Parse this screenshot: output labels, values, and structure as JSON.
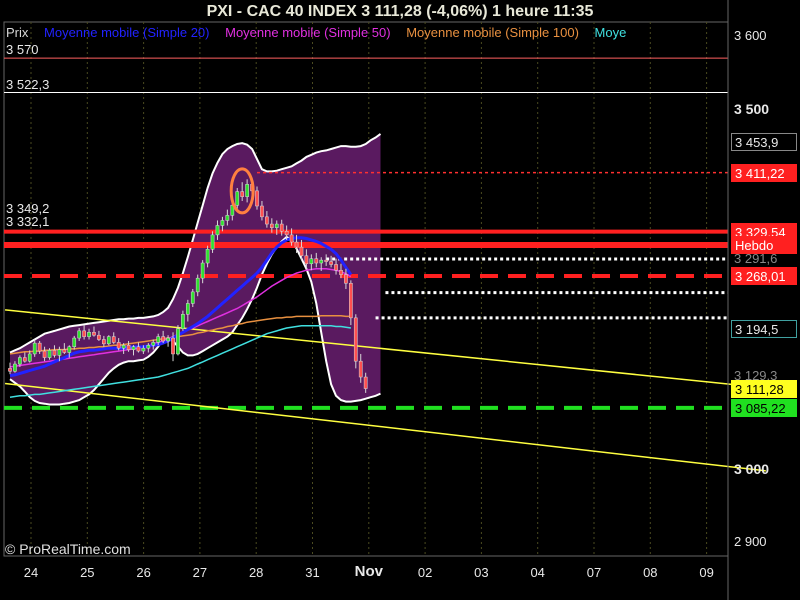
{
  "header": {
    "title": "PXI - CAC 40 INDEX     3 111,28 (-4,06%)     1 heure  11:35"
  },
  "legend": [
    {
      "label": "Prix",
      "color": "#d8d8d8"
    },
    {
      "label": "Moyenne mobile (Simple 20)",
      "color": "#2222ff"
    },
    {
      "label": "Moyenne mobile (Simple 50)",
      "color": "#e030e0"
    },
    {
      "label": "Moyenne mobile (Simple 100)",
      "color": "#e89040"
    },
    {
      "label": "Moye",
      "color": "#40e0e0"
    }
  ],
  "copyright": "© ProRealTime.com",
  "chart_data": {
    "type": "candlestick",
    "ylim": [
      2880,
      3620
    ],
    "y_ticks": [
      {
        "value": 3600,
        "label": "3 600",
        "major": false
      },
      {
        "value": 3500,
        "label": "3 500",
        "major": true
      },
      {
        "value": 3000,
        "label": "3 000",
        "major": true
      },
      {
        "value": 2900,
        "label": "2 900",
        "major": false
      }
    ],
    "x_labels": [
      {
        "label": "24",
        "bold": false
      },
      {
        "label": "25",
        "bold": false
      },
      {
        "label": "26",
        "bold": false
      },
      {
        "label": "27",
        "bold": false
      },
      {
        "label": "28",
        "bold": false
      },
      {
        "label": "31",
        "bold": false
      },
      {
        "label": "Nov",
        "bold": true
      },
      {
        "label": "02",
        "bold": false
      },
      {
        "label": "03",
        "bold": false
      },
      {
        "label": "04",
        "bold": false
      },
      {
        "label": "07",
        "bold": false
      },
      {
        "label": "08",
        "bold": false
      },
      {
        "label": "09",
        "bold": false
      }
    ],
    "price_boxes": [
      {
        "label": "3 453,9",
        "value": 3453.9,
        "bg": "#000000",
        "fg": "#e8e8e8",
        "border": "#888888"
      },
      {
        "label": "3 411,22",
        "value": 3411.22,
        "bg": "#ff2020",
        "fg": "#ffffff",
        "border": "#ff2020"
      },
      {
        "label": "3 329,54",
        "value": 3329.54,
        "bg": "#ff2020",
        "fg": "#ffffff",
        "border": "#ff2020"
      },
      {
        "label": "Hebdo",
        "value": 3311,
        "bg": "#ff2020",
        "fg": "#ffffff",
        "border": "#ff2020"
      },
      {
        "label": "3 268,01",
        "value": 3268.01,
        "bg": "#ff2020",
        "fg": "#ffffff",
        "border": "#ff2020"
      },
      {
        "label": "3 194,5",
        "value": 3194.5,
        "bg": "#000000",
        "fg": "#e8e8e8",
        "border": "#40a0a0"
      },
      {
        "label": "3 111,28",
        "value": 3111.28,
        "bg": "#ffff20",
        "fg": "#000000",
        "border": "#ffff20"
      },
      {
        "label": "3 085,22",
        "value": 3085.22,
        "bg": "#20e020",
        "fg": "#000000",
        "border": "#20e020"
      }
    ],
    "partial_labels": [
      {
        "label": "3 291,6",
        "value": 3291.6
      },
      {
        "label": "3 129,3",
        "value": 3129.3
      }
    ],
    "horizontal_labels": [
      {
        "label": "3 570",
        "value": 3570
      },
      {
        "label": "3 522,3",
        "value": 3522.3
      },
      {
        "label": "3 349,2",
        "value": 3349.2
      },
      {
        "label": "3 332,1",
        "value": 3332.1
      }
    ],
    "levels": [
      {
        "value": 3570,
        "color": "#ff6060",
        "style": "solid",
        "width": 1
      },
      {
        "value": 3522.3,
        "color": "#ffffff",
        "style": "solid",
        "width": 1
      },
      {
        "value": 3411.22,
        "color": "#ff3030",
        "style": "dotted",
        "width": 1.5,
        "from_index": 50
      },
      {
        "value": 3329.54,
        "color": "#ff2020",
        "style": "solid",
        "width": 4
      },
      {
        "value": 3311,
        "color": "#ff2020",
        "style": "solid",
        "width": 6
      },
      {
        "value": 3291.6,
        "color": "#ffffff",
        "style": "dotted",
        "width": 3,
        "from_index": 64
      },
      {
        "value": 3268.01,
        "color": "#ff2020",
        "style": "dashed",
        "width": 4
      },
      {
        "value": 3245,
        "color": "#ffffff",
        "style": "dotted",
        "width": 3,
        "from_index": 76
      },
      {
        "value": 3210,
        "color": "#ffffff",
        "style": "dotted",
        "width": 3,
        "from_index": 74
      },
      {
        "value": 3085.22,
        "color": "#20e020",
        "style": "dashed",
        "width": 4
      }
    ],
    "trendlines": [
      {
        "from": [
          -1,
          3221
        ],
        "to": [
          153,
          3113
        ],
        "color": "#ffff40"
      },
      {
        "from": [
          -1,
          3119
        ],
        "to": [
          153,
          2998
        ],
        "color": "#ffff40"
      }
    ],
    "bollinger": {
      "upper": [
        3162,
        3165,
        3168,
        3172,
        3176,
        3180,
        3184,
        3188,
        3190,
        3192,
        3194,
        3196,
        3198,
        3199,
        3200,
        3201,
        3202,
        3203,
        3204,
        3205,
        3206,
        3207,
        3208,
        3208,
        3209,
        3209,
        3210,
        3210,
        3211,
        3212,
        3214,
        3218,
        3224,
        3236,
        3252,
        3272,
        3294,
        3318,
        3342,
        3366,
        3390,
        3410,
        3425,
        3437,
        3444,
        3448,
        3451,
        3452,
        3450,
        3444,
        3430,
        3416,
        3413,
        3413,
        3414,
        3416,
        3418,
        3420,
        3424,
        3428,
        3433,
        3436,
        3439,
        3441,
        3442,
        3444,
        3446,
        3448,
        3448,
        3447,
        3447,
        3448,
        3451,
        3456,
        3460,
        3465
      ],
      "lower": [
        3125,
        3120,
        3115,
        3108,
        3100,
        3095,
        3092,
        3091,
        3090,
        3090,
        3090,
        3091,
        3092,
        3094,
        3096,
        3100,
        3104,
        3110,
        3118,
        3126,
        3134,
        3140,
        3145,
        3148,
        3150,
        3150,
        3151,
        3152,
        3156,
        3162,
        3170,
        3180,
        3182,
        3178,
        3170,
        3162,
        3158,
        3158,
        3160,
        3164,
        3168,
        3172,
        3176,
        3180,
        3184,
        3190,
        3200,
        3210,
        3222,
        3236,
        3252,
        3270,
        3285,
        3298,
        3308,
        3316,
        3322,
        3318,
        3306,
        3292,
        3278,
        3260,
        3230,
        3190,
        3150,
        3118,
        3102,
        3096,
        3094,
        3094,
        3095,
        3096,
        3098,
        3100,
        3102,
        3105
      ],
      "fill": "#5a1a60",
      "stroke": "#ffffff"
    },
    "ma20": [
      3130,
      3131,
      3133,
      3135,
      3137,
      3139,
      3141,
      3143,
      3146,
      3149,
      3152,
      3155,
      3158,
      3161,
      3163,
      3164,
      3165,
      3165,
      3166,
      3167,
      3168,
      3168,
      3168,
      3168,
      3169,
      3170,
      3170,
      3170,
      3171,
      3172,
      3173,
      3175,
      3178,
      3182,
      3186,
      3190,
      3194,
      3198,
      3202,
      3207,
      3212,
      3218,
      3224,
      3230,
      3236,
      3242,
      3248,
      3254,
      3260,
      3266,
      3272,
      3280,
      3290,
      3300,
      3308,
      3314,
      3318,
      3320,
      3321,
      3321,
      3320,
      3318,
      3316,
      3313,
      3309,
      3305,
      3299,
      3290,
      3280,
      3270
    ],
    "ma50": [
      3142,
      3143,
      3144,
      3145,
      3146,
      3147,
      3148,
      3149,
      3150,
      3151,
      3152,
      3153,
      3154,
      3155,
      3156,
      3157,
      3158,
      3159,
      3160,
      3161,
      3162,
      3163,
      3164,
      3165,
      3166,
      3167,
      3168,
      3170,
      3172,
      3174,
      3176,
      3178,
      3181,
      3184,
      3187,
      3190,
      3193,
      3196,
      3199,
      3202,
      3205,
      3208,
      3211,
      3214,
      3217,
      3220,
      3223,
      3227,
      3231,
      3235,
      3239,
      3244,
      3249,
      3254,
      3258,
      3262,
      3266,
      3269,
      3272,
      3274,
      3276,
      3277,
      3278,
      3278,
      3278,
      3277,
      3276,
      3274,
      3271,
      3267
    ],
    "ma100": [
      3160,
      3161,
      3162,
      3163,
      3163,
      3164,
      3164,
      3165,
      3165,
      3166,
      3166,
      3166,
      3167,
      3167,
      3168,
      3168,
      3169,
      3169,
      3170,
      3170,
      3171,
      3172,
      3172,
      3173,
      3174,
      3175,
      3176,
      3177,
      3178,
      3179,
      3180,
      3181,
      3182,
      3183,
      3184,
      3185,
      3186,
      3187,
      3189,
      3190,
      3192,
      3193,
      3195,
      3196,
      3198,
      3199,
      3201,
      3202,
      3204,
      3205,
      3206,
      3207,
      3208,
      3209,
      3210,
      3210,
      3211,
      3211,
      3212,
      3212,
      3212,
      3212,
      3212,
      3213,
      3213,
      3213,
      3213,
      3213,
      3212,
      3212
    ],
    "ma200": [
      3100,
      3101,
      3102,
      3102,
      3103,
      3104,
      3104,
      3105,
      3106,
      3107,
      3108,
      3109,
      3110,
      3111,
      3112,
      3113,
      3114,
      3115,
      3116,
      3117,
      3118,
      3119,
      3120,
      3121,
      3122,
      3123,
      3124,
      3125,
      3126,
      3127,
      3128,
      3130,
      3132,
      3134,
      3136,
      3138,
      3140,
      3143,
      3146,
      3149,
      3152,
      3155,
      3158,
      3161,
      3164,
      3167,
      3170,
      3173,
      3176,
      3179,
      3182,
      3185,
      3188,
      3190,
      3192,
      3194,
      3196,
      3197,
      3198,
      3199,
      3199,
      3199,
      3199,
      3199,
      3199,
      3199,
      3198,
      3198,
      3197,
      3196
    ],
    "ma_colors": {
      "ma20": "#2222ff",
      "ma50": "#e030e0",
      "ma100": "#e89040",
      "ma200": "#40e0e0"
    },
    "candles": [
      {
        "o": 3140,
        "h": 3148,
        "l": 3132,
        "c": 3136
      },
      {
        "o": 3136,
        "h": 3150,
        "l": 3134,
        "c": 3146
      },
      {
        "o": 3146,
        "h": 3158,
        "l": 3142,
        "c": 3155
      },
      {
        "o": 3155,
        "h": 3162,
        "l": 3148,
        "c": 3150
      },
      {
        "o": 3150,
        "h": 3165,
        "l": 3148,
        "c": 3160
      },
      {
        "o": 3160,
        "h": 3180,
        "l": 3156,
        "c": 3175
      },
      {
        "o": 3175,
        "h": 3178,
        "l": 3160,
        "c": 3164
      },
      {
        "o": 3164,
        "h": 3170,
        "l": 3150,
        "c": 3155
      },
      {
        "o": 3155,
        "h": 3168,
        "l": 3152,
        "c": 3165
      },
      {
        "o": 3165,
        "h": 3172,
        "l": 3155,
        "c": 3158
      },
      {
        "o": 3158,
        "h": 3170,
        "l": 3150,
        "c": 3166
      },
      {
        "o": 3166,
        "h": 3175,
        "l": 3160,
        "c": 3162
      },
      {
        "o": 3162,
        "h": 3172,
        "l": 3155,
        "c": 3170
      },
      {
        "o": 3170,
        "h": 3185,
        "l": 3166,
        "c": 3182
      },
      {
        "o": 3182,
        "h": 3196,
        "l": 3178,
        "c": 3192
      },
      {
        "o": 3192,
        "h": 3200,
        "l": 3180,
        "c": 3184
      },
      {
        "o": 3184,
        "h": 3195,
        "l": 3180,
        "c": 3190
      },
      {
        "o": 3190,
        "h": 3198,
        "l": 3184,
        "c": 3186
      },
      {
        "o": 3186,
        "h": 3192,
        "l": 3178,
        "c": 3180
      },
      {
        "o": 3180,
        "h": 3185,
        "l": 3170,
        "c": 3174
      },
      {
        "o": 3174,
        "h": 3186,
        "l": 3172,
        "c": 3184
      },
      {
        "o": 3184,
        "h": 3190,
        "l": 3174,
        "c": 3176
      },
      {
        "o": 3176,
        "h": 3182,
        "l": 3165,
        "c": 3168
      },
      {
        "o": 3168,
        "h": 3175,
        "l": 3160,
        "c": 3172
      },
      {
        "o": 3172,
        "h": 3178,
        "l": 3163,
        "c": 3166
      },
      {
        "o": 3166,
        "h": 3172,
        "l": 3158,
        "c": 3170
      },
      {
        "o": 3170,
        "h": 3176,
        "l": 3162,
        "c": 3164
      },
      {
        "o": 3164,
        "h": 3172,
        "l": 3160,
        "c": 3168
      },
      {
        "o": 3168,
        "h": 3175,
        "l": 3162,
        "c": 3172
      },
      {
        "o": 3172,
        "h": 3180,
        "l": 3166,
        "c": 3176
      },
      {
        "o": 3176,
        "h": 3188,
        "l": 3172,
        "c": 3184
      },
      {
        "o": 3184,
        "h": 3192,
        "l": 3175,
        "c": 3178
      },
      {
        "o": 3178,
        "h": 3186,
        "l": 3170,
        "c": 3182
      },
      {
        "o": 3182,
        "h": 3190,
        "l": 3150,
        "c": 3160
      },
      {
        "o": 3160,
        "h": 3200,
        "l": 3158,
        "c": 3195
      },
      {
        "o": 3195,
        "h": 3220,
        "l": 3192,
        "c": 3215
      },
      {
        "o": 3215,
        "h": 3235,
        "l": 3205,
        "c": 3230
      },
      {
        "o": 3230,
        "h": 3250,
        "l": 3225,
        "c": 3246
      },
      {
        "o": 3246,
        "h": 3270,
        "l": 3240,
        "c": 3265
      },
      {
        "o": 3265,
        "h": 3290,
        "l": 3258,
        "c": 3286
      },
      {
        "o": 3286,
        "h": 3310,
        "l": 3280,
        "c": 3305
      },
      {
        "o": 3305,
        "h": 3330,
        "l": 3300,
        "c": 3325
      },
      {
        "o": 3325,
        "h": 3345,
        "l": 3318,
        "c": 3338
      },
      {
        "o": 3338,
        "h": 3350,
        "l": 3330,
        "c": 3345
      },
      {
        "o": 3345,
        "h": 3360,
        "l": 3338,
        "c": 3352
      },
      {
        "o": 3352,
        "h": 3372,
        "l": 3345,
        "c": 3366
      },
      {
        "o": 3366,
        "h": 3390,
        "l": 3360,
        "c": 3385
      },
      {
        "o": 3385,
        "h": 3398,
        "l": 3372,
        "c": 3378
      },
      {
        "o": 3378,
        "h": 3402,
        "l": 3370,
        "c": 3395
      },
      {
        "o": 3395,
        "h": 3400,
        "l": 3380,
        "c": 3386
      },
      {
        "o": 3386,
        "h": 3392,
        "l": 3360,
        "c": 3365
      },
      {
        "o": 3365,
        "h": 3372,
        "l": 3345,
        "c": 3350
      },
      {
        "o": 3350,
        "h": 3358,
        "l": 3335,
        "c": 3340
      },
      {
        "o": 3340,
        "h": 3348,
        "l": 3328,
        "c": 3335
      },
      {
        "o": 3335,
        "h": 3345,
        "l": 3325,
        "c": 3340
      },
      {
        "o": 3340,
        "h": 3346,
        "l": 3324,
        "c": 3330
      },
      {
        "o": 3330,
        "h": 3338,
        "l": 3318,
        "c": 3325
      },
      {
        "o": 3325,
        "h": 3334,
        "l": 3310,
        "c": 3315
      },
      {
        "o": 3315,
        "h": 3325,
        "l": 3300,
        "c": 3308
      },
      {
        "o": 3308,
        "h": 3318,
        "l": 3290,
        "c": 3296
      },
      {
        "o": 3296,
        "h": 3305,
        "l": 3278,
        "c": 3285
      },
      {
        "o": 3285,
        "h": 3298,
        "l": 3276,
        "c": 3292
      },
      {
        "o": 3292,
        "h": 3300,
        "l": 3280,
        "c": 3286
      },
      {
        "o": 3286,
        "h": 3294,
        "l": 3275,
        "c": 3290
      },
      {
        "o": 3290,
        "h": 3298,
        "l": 3282,
        "c": 3288
      },
      {
        "o": 3288,
        "h": 3296,
        "l": 3280,
        "c": 3284
      },
      {
        "o": 3284,
        "h": 3292,
        "l": 3270,
        "c": 3276
      },
      {
        "o": 3276,
        "h": 3285,
        "l": 3265,
        "c": 3270
      },
      {
        "o": 3270,
        "h": 3278,
        "l": 3250,
        "c": 3258
      },
      {
        "o": 3258,
        "h": 3262,
        "l": 3200,
        "c": 3210
      },
      {
        "o": 3210,
        "h": 3215,
        "l": 3140,
        "c": 3150
      },
      {
        "o": 3150,
        "h": 3160,
        "l": 3120,
        "c": 3128
      },
      {
        "o": 3128,
        "h": 3134,
        "l": 3106,
        "c": 3112
      }
    ],
    "highlight_circle": {
      "index": 47,
      "value": 3386
    }
  }
}
